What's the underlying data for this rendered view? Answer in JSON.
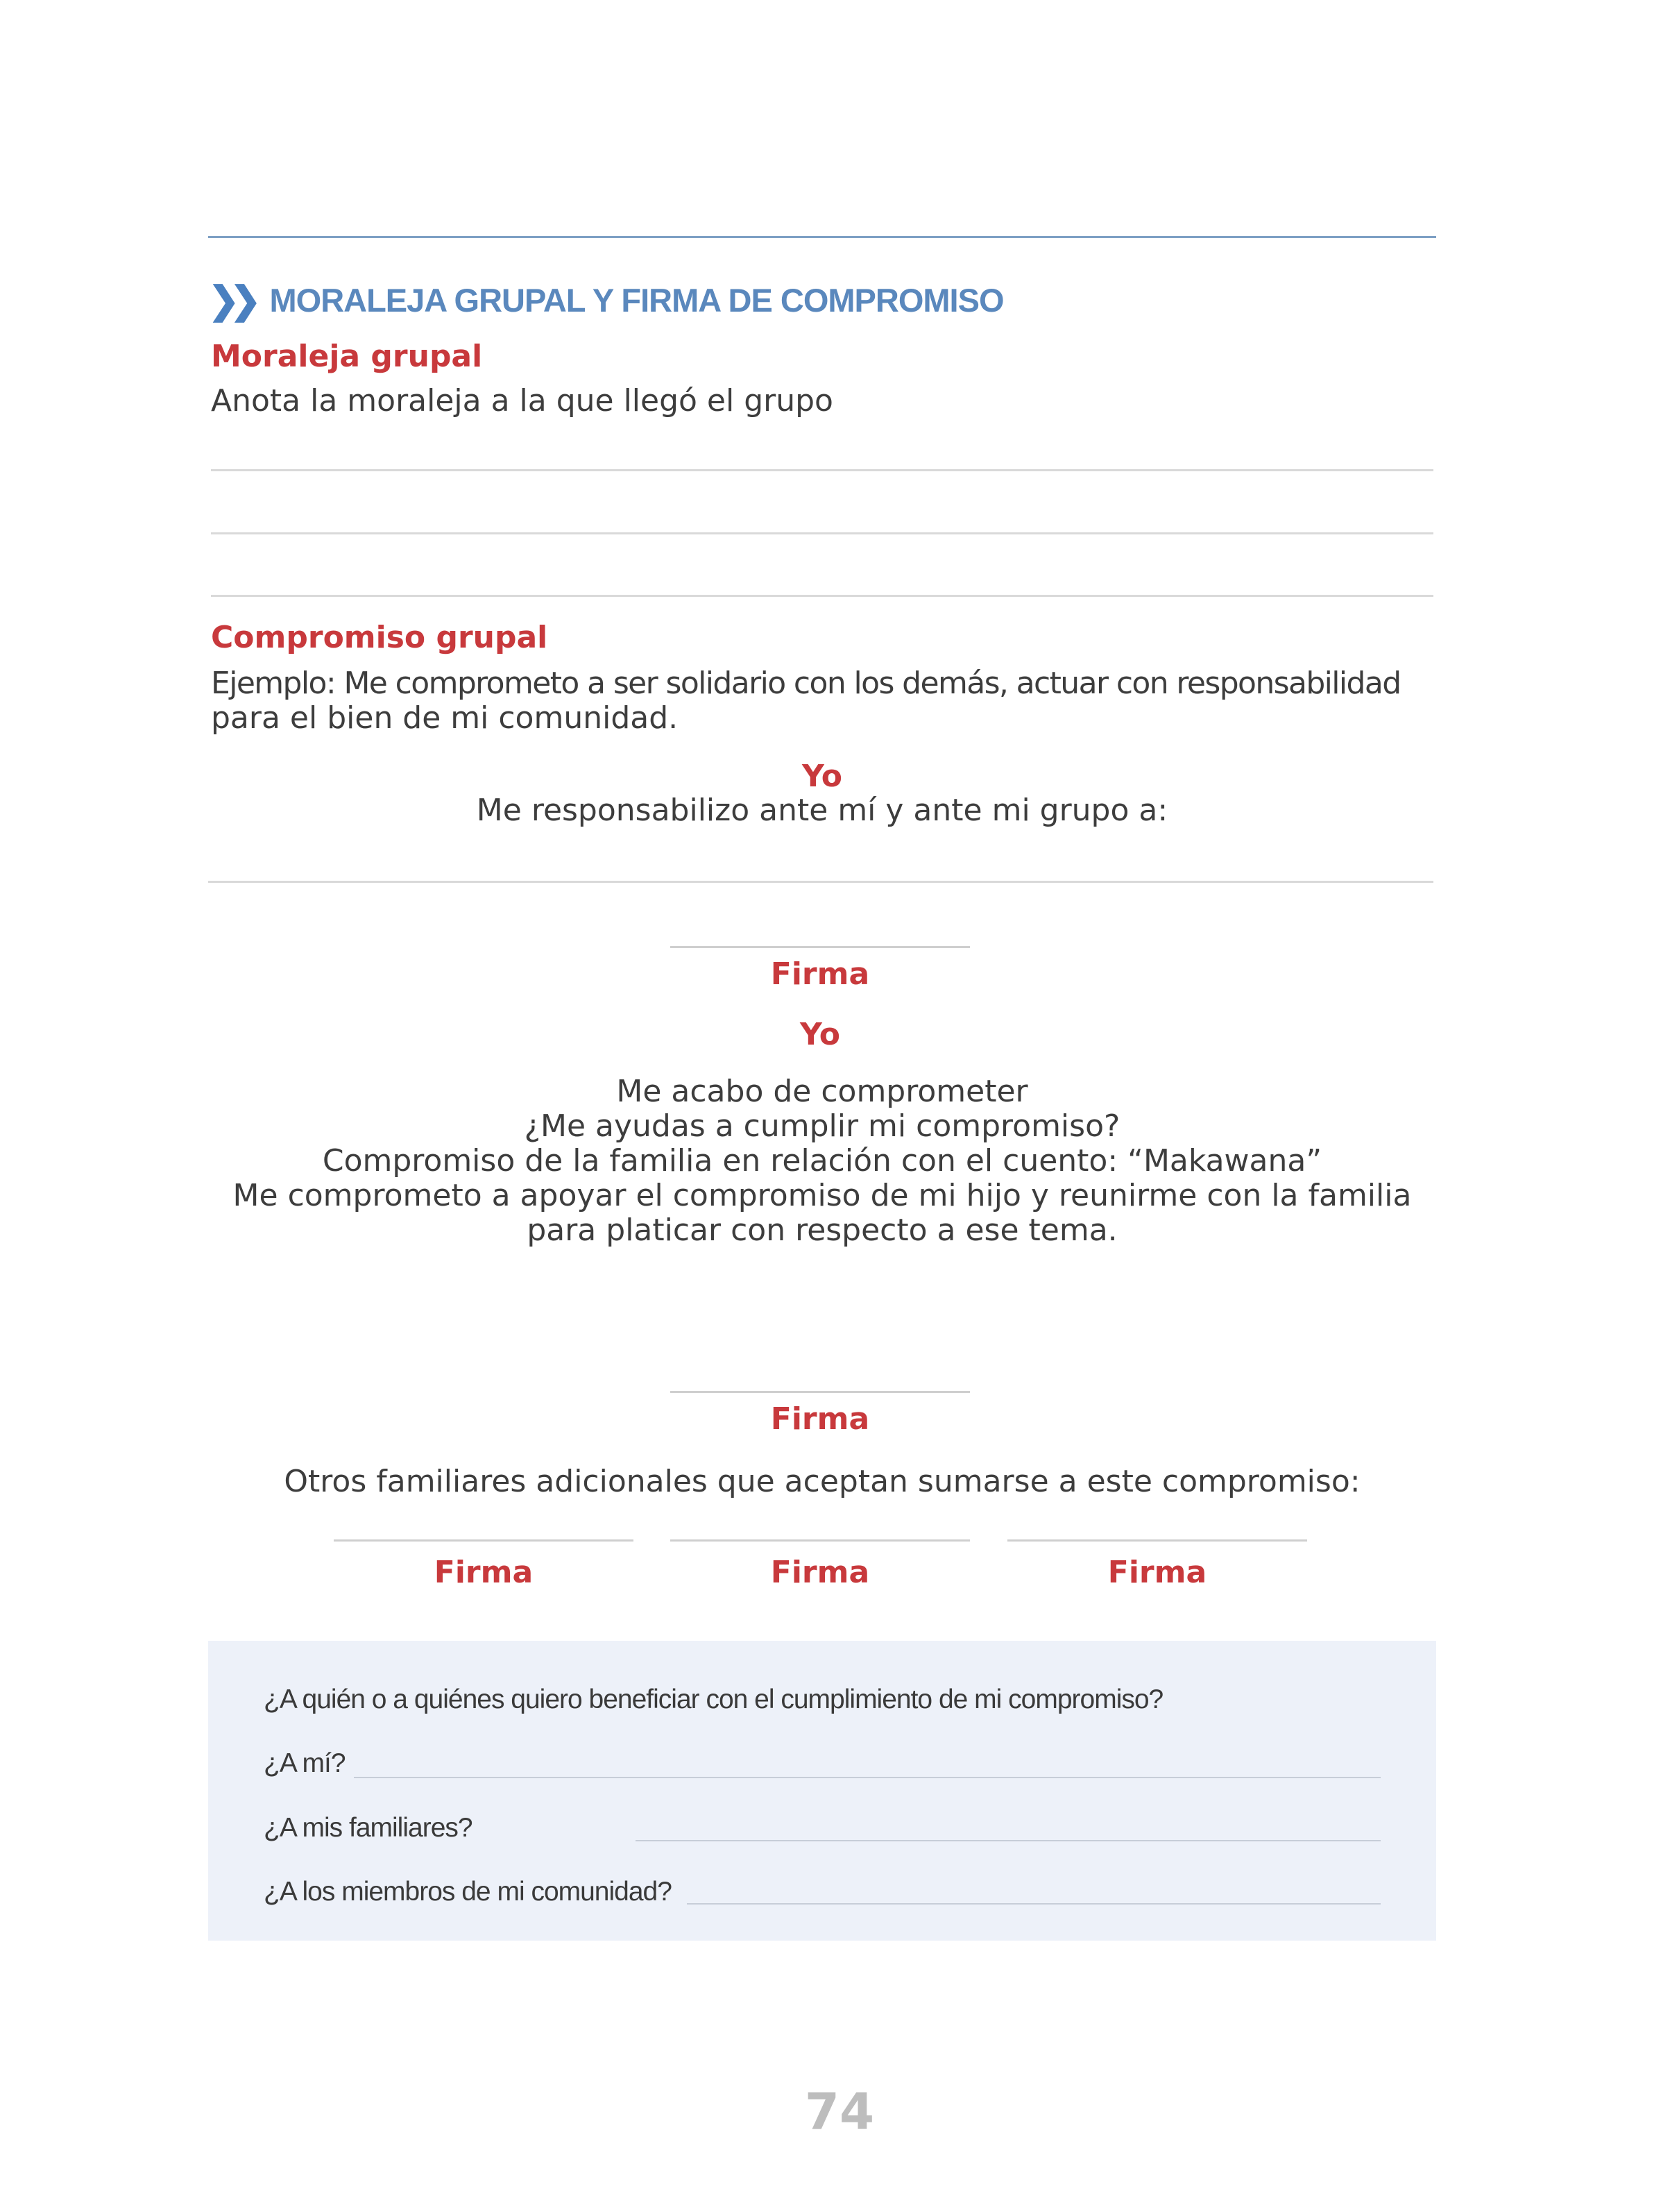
{
  "section": {
    "icon": "double-chevron-right-icon",
    "title": "MORALEJA GRUPAL Y FIRMA DE COMPROMISO"
  },
  "moraleja": {
    "heading": "Moraleja grupal",
    "instruction": "Anota la moraleja a la que llegó el grupo"
  },
  "compromiso": {
    "heading": "Compromiso grupal",
    "example_line1": "Ejemplo: Me comprometo a ser solidario con los demás, actuar con responsabilidad",
    "example_line2": "para el bien de mi comunidad.",
    "yo1": "Yo",
    "responsabilizo": "Me responsabilizo ante mí y ante mi grupo a:",
    "firma1": "Firma",
    "yo2": "Yo",
    "family_lines": [
      "Me acabo de comprometer",
      "¿Me ayudas a cumplir mi compromiso?",
      "Compromiso de la familia en relación con el cuento: “Makawana”",
      "Me comprometo a apoyar el compromiso de mi hijo y reunirme con la familia",
      "para platicar con respecto a ese tema."
    ],
    "firma2": "Firma",
    "otros": "Otros familiares adicionales que aceptan sumarse a este compromiso:",
    "firmas_extra": [
      "Firma",
      "Firma",
      "Firma"
    ]
  },
  "questions": {
    "intro": "¿A quién o a quiénes quiero beneficiar con el cumplimiento de mi compromiso?",
    "q1": "¿A mí?",
    "q2": "¿A mis familiares?",
    "q3": "¿A los miembros de mi comunidad?"
  },
  "page_number": "74",
  "colors": {
    "accent_red": "#c8393c",
    "accent_blue": "#5a88bd",
    "box_bg": "#edf1f9"
  }
}
